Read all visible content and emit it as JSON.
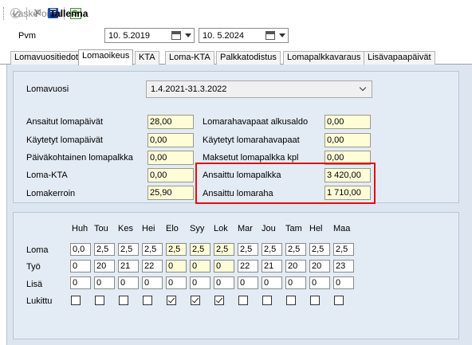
{
  "toolbar": {
    "laske": "Laske",
    "poista": "Poista",
    "tallenna": "Tallenna"
  },
  "dates": {
    "label": "Pvm",
    "from": "10.  5.2019",
    "to": "10.  5.2024"
  },
  "tabs": [
    "Lomavuositiedot",
    "Lomaoikeus",
    "KTA",
    "Loma-KTA",
    "Palkkatodistus",
    "Lomapalkkavaraus",
    "Lisävapaapäivät"
  ],
  "active_tab": "Lomaoikeus",
  "lomavuosi": {
    "label": "Lomavuosi",
    "value": "1.4.2021-31.3.2022"
  },
  "left_fields": [
    {
      "label": "Ansaitut lomapäivät",
      "value": "28,00"
    },
    {
      "label": "Käytetyt lomapäivät",
      "value": "0,00"
    },
    {
      "label": "Päiväkohtainen lomapalkka",
      "value": "0,00"
    },
    {
      "label": "Loma-KTA",
      "value": "0,00"
    },
    {
      "label": "Lomakerroin",
      "value": "25,90"
    }
  ],
  "right_fields": [
    {
      "label": "Lomarahavapaat alkusaldo",
      "value": "0,00"
    },
    {
      "label": "Käytetyt lomarahavapaat",
      "value": "0,00"
    },
    {
      "label": "Maksetut lomapalkka kpl",
      "value": "0,00"
    },
    {
      "label": "Ansaittu lomapalkka",
      "value": "3 420,00"
    },
    {
      "label": "Ansaittu lomaraha",
      "value": "1 710,00"
    }
  ],
  "months": [
    "Huh",
    "Tou",
    "Kes",
    "Hei",
    "Elo",
    "Syy",
    "Lok",
    "Mar",
    "Jou",
    "Tam",
    "Hel",
    "Maa"
  ],
  "rows": {
    "loma": {
      "label": "Loma",
      "values": [
        "0,0",
        "2,5",
        "2,5",
        "2,5",
        "2,5",
        "2,5",
        "2,5",
        "2,5",
        "2,5",
        "2,5",
        "2,5",
        "2,5"
      ]
    },
    "tyo": {
      "label": "Työ",
      "values": [
        "0",
        "20",
        "21",
        "22",
        "0",
        "0",
        "0",
        "22",
        "21",
        "20",
        "20",
        "23"
      ]
    },
    "lisa": {
      "label": "Lisä",
      "values": [
        "0",
        "0",
        "0",
        "0",
        "0",
        "0",
        "0",
        "0",
        "0",
        "0",
        "0",
        "0"
      ]
    },
    "lukittu": {
      "label": "Lukittu",
      "values": [
        false,
        false,
        false,
        false,
        true,
        true,
        true,
        false,
        false,
        false,
        false,
        false
      ]
    }
  },
  "colors": {
    "field_yellow": "#fefdd8",
    "highlight_red": "#e01010",
    "panel_blue": "#dde6f0"
  }
}
